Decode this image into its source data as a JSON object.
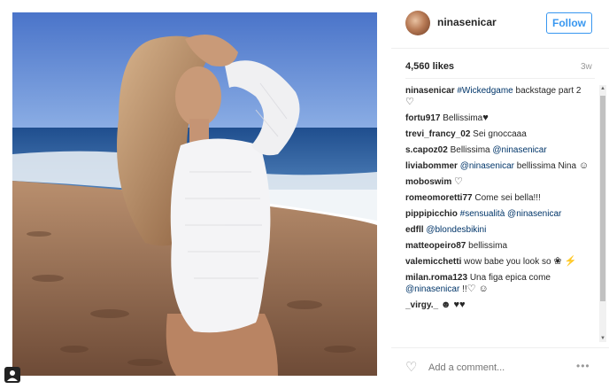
{
  "post": {
    "username": "ninasenicar",
    "follow_label": "Follow",
    "likes": "4,560 likes",
    "time": "3w",
    "comment_placeholder": "Add a comment...",
    "more_label": "•••"
  },
  "comments": [
    {
      "user": "ninasenicar",
      "parts": [
        {
          "t": "link",
          "v": "#Wickedgame"
        },
        {
          "t": "text",
          "v": " backstage part 2 "
        },
        {
          "t": "heart",
          "v": "♡"
        }
      ]
    },
    {
      "user": "fortu917",
      "parts": [
        {
          "t": "text",
          "v": "Bellissima"
        },
        {
          "t": "heart",
          "v": "♥"
        }
      ]
    },
    {
      "user": "trevi_francy_02",
      "parts": [
        {
          "t": "text",
          "v": "Sei gnoccaaa"
        }
      ]
    },
    {
      "user": "s.capoz02",
      "parts": [
        {
          "t": "text",
          "v": "Bellissima "
        },
        {
          "t": "link",
          "v": "@ninasenicar"
        }
      ]
    },
    {
      "user": "liviabommer",
      "parts": [
        {
          "t": "link",
          "v": "@ninasenicar"
        },
        {
          "t": "text",
          "v": " bellissima Nina "
        },
        {
          "t": "heart",
          "v": "☺"
        }
      ]
    },
    {
      "user": "moboswim",
      "parts": [
        {
          "t": "heart",
          "v": "♡"
        }
      ]
    },
    {
      "user": "romeomoretti77",
      "parts": [
        {
          "t": "text",
          "v": "Come sei bella!!!"
        }
      ]
    },
    {
      "user": "pippipicchio",
      "parts": [
        {
          "t": "link",
          "v": "#sensualità"
        },
        {
          "t": "text",
          "v": " "
        },
        {
          "t": "link",
          "v": "@ninasenicar"
        }
      ]
    },
    {
      "user": "edfll",
      "parts": [
        {
          "t": "link",
          "v": "@blondesbikini"
        }
      ]
    },
    {
      "user": "matteopeiro87",
      "parts": [
        {
          "t": "text",
          "v": "bellissima"
        }
      ]
    },
    {
      "user": "valemicchetti",
      "parts": [
        {
          "t": "text",
          "v": "wow babe you look so "
        },
        {
          "t": "heart",
          "v": "❀ ⚡"
        }
      ]
    },
    {
      "user": "milan.roma123",
      "parts": [
        {
          "t": "text",
          "v": "Una figa epica come "
        },
        {
          "t": "link",
          "v": "@ninasenicar"
        },
        {
          "t": "text",
          "v": " !!"
        },
        {
          "t": "heart",
          "v": "♡ ☺"
        }
      ]
    },
    {
      "user": "_virgy._",
      "parts": [
        {
          "t": "heart",
          "v": "☻ ♥♥"
        }
      ]
    }
  ]
}
